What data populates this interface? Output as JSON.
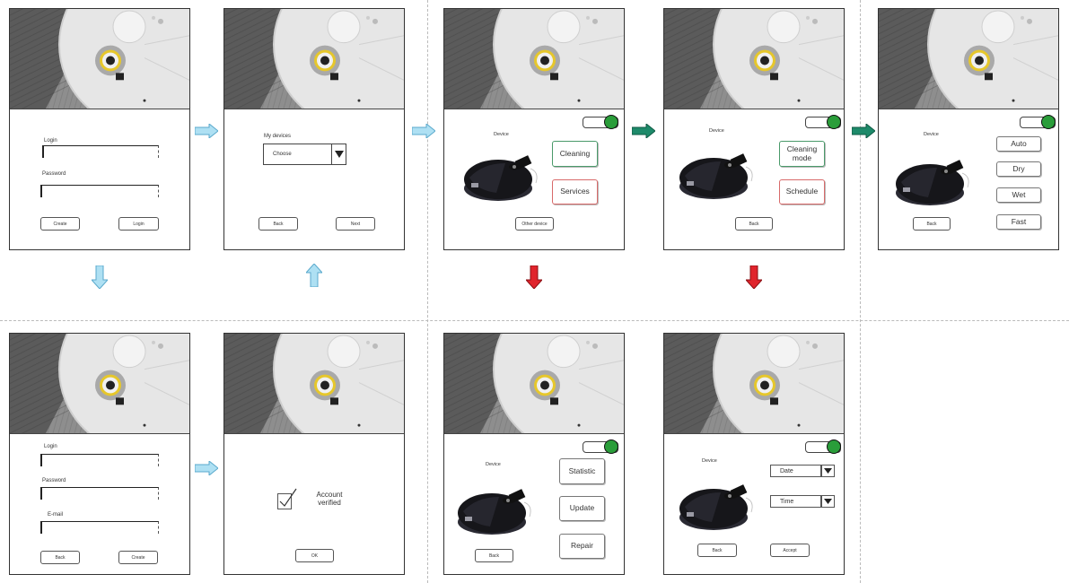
{
  "screens": {
    "login": {
      "login_label": "Login",
      "password_label": "Password",
      "create_btn": "Create",
      "login_btn": "Login"
    },
    "devices": {
      "title": "My devices",
      "select_value": "Choose",
      "back_btn": "Back",
      "next_btn": "Next"
    },
    "device_main": {
      "device_label": "Device",
      "cleaning_btn": "Cleaning",
      "services_btn": "Services",
      "other_device_btn": "Other device"
    },
    "cleaning": {
      "device_label": "Device",
      "cleaning_mode_btn": "Cleaning mode",
      "schedule_btn": "Schedule",
      "back_btn": "Back"
    },
    "modes": {
      "device_label": "Device",
      "auto_btn": "Auto",
      "dry_btn": "Dry",
      "wet_btn": "Wet",
      "fast_btn": "Fast",
      "back_btn": "Back"
    },
    "register": {
      "login_label": "Login",
      "password_label": "Password",
      "email_label": "E-mail",
      "back_btn": "Back",
      "create_btn": "Create"
    },
    "verified": {
      "message": "Account verified",
      "ok_btn": "OK"
    },
    "services": {
      "device_label": "Device",
      "statistic_btn": "Statistic",
      "update_btn": "Update",
      "repair_btn": "Repair",
      "back_btn": "Back"
    },
    "schedule": {
      "device_label": "Device",
      "date_select": "Date",
      "time_select": "Time",
      "back_btn": "Back",
      "accept_btn": "Accept"
    }
  },
  "colors": {
    "light_arrow": "#8ecfe8",
    "green_arrow": "#1e8a6a",
    "red_arrow": "#e0242c",
    "toggle_on": "#2a9d3a"
  }
}
